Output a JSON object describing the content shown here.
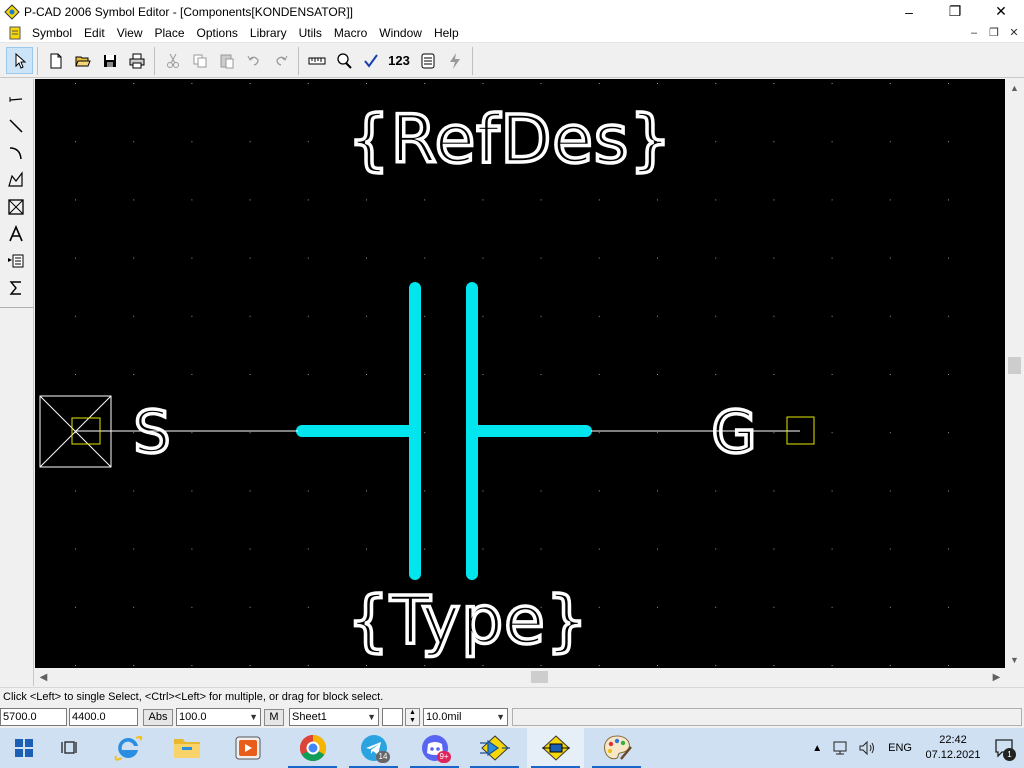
{
  "window": {
    "title": "P-CAD 2006 Symbol Editor - [Components[KONDENSATOR]]",
    "minimize": "–",
    "restore": "❐",
    "close": "✕"
  },
  "menu": [
    "Symbol",
    "Edit",
    "View",
    "Place",
    "Options",
    "Library",
    "Utils",
    "Macro",
    "Window",
    "Help"
  ],
  "toolbar": {
    "icons": [
      "select-arrow",
      "new-file",
      "open-folder",
      "save-disk",
      "print",
      "cut",
      "copy",
      "paste",
      "undo",
      "redo",
      "ruler",
      "zoom",
      "check",
      "renumber",
      "symbol-wizard",
      "lightning"
    ],
    "renumber_label": "123"
  },
  "left_tools": [
    "place-pin",
    "place-line",
    "place-arc",
    "place-polygon",
    "place-field",
    "place-text",
    "place-attribute",
    "place-ieee-symbol"
  ],
  "canvas": {
    "background": "#000000",
    "symbol_color": "#00e5ee",
    "text_color": "#ffffff",
    "pin_color": "#e6e600",
    "refdes_text": "{RefDes}",
    "type_text": "{Type}",
    "pin_left_label": "S",
    "pin_right_label": "G"
  },
  "status": {
    "message": "Click <Left> to single Select, <Ctrl><Left> for multiple, or drag for block select.",
    "x_coord": "5700.0",
    "y_coord": "4400.0",
    "abs_button": "Abs",
    "zoom": "100.0",
    "m_button": "M",
    "sheet": "Sheet1",
    "grid": "10.0mil"
  },
  "taskbar": {
    "apps": [
      "start",
      "task-view",
      "internet-explorer",
      "file-explorer",
      "media-player",
      "chrome",
      "telegram",
      "discord",
      "pcad-schematic",
      "pcad-symbol-editor",
      "paint"
    ],
    "telegram_badge": "14",
    "discord_badge": "9+",
    "language": "ENG",
    "time": "22:42",
    "date": "07.12.2021",
    "notification_count": "1"
  }
}
